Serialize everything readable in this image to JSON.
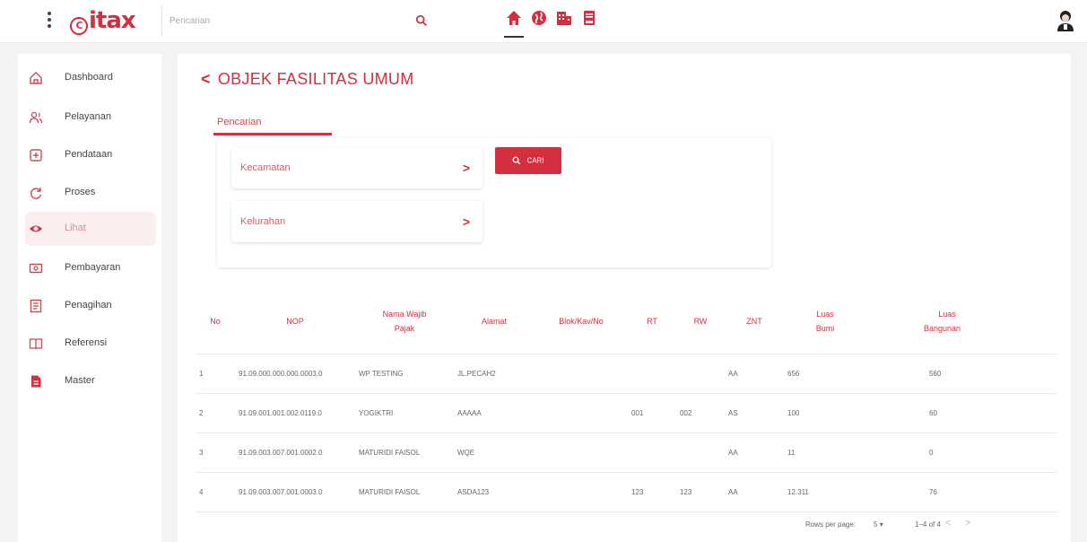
{
  "colors": {
    "accent": "#d32f3f",
    "active_bg": "#fbeeef",
    "background": "#f3f3f3"
  },
  "header": {
    "logo_text": "itax",
    "search_placeholder": "Pencarian"
  },
  "sidebar": {
    "items": [
      {
        "label": "Dashboard",
        "icon": "home-outline-icon"
      },
      {
        "label": "Pelayanan",
        "icon": "users-icon"
      },
      {
        "label": "Pendataan",
        "icon": "add-box-icon"
      },
      {
        "label": "Proses",
        "icon": "sync-icon"
      },
      {
        "label": "Lihat",
        "icon": "eye-icon",
        "active": true
      },
      {
        "label": "Pembayaran",
        "icon": "payment-icon"
      },
      {
        "label": "Penagihan",
        "icon": "bill-icon"
      },
      {
        "label": "Referensi",
        "icon": "book-icon"
      },
      {
        "label": "Master",
        "icon": "file-icon"
      }
    ]
  },
  "main": {
    "title": "OBJEK FASILITAS UMUM",
    "tab": "Pencarian",
    "filters": {
      "kecamatan": "Kecamatan",
      "kelurahan": "Kelurahan"
    },
    "cari_label": "CARI"
  },
  "table": {
    "headers": [
      {
        "line1": "No",
        "line2": ""
      },
      {
        "line1": "NOP",
        "line2": ""
      },
      {
        "line1": "Nama Wajib",
        "line2": "Pajak"
      },
      {
        "line1": "Alamat",
        "line2": ""
      },
      {
        "line1": "Blok/Kav/No",
        "line2": ""
      },
      {
        "line1": "RT",
        "line2": ""
      },
      {
        "line1": "RW",
        "line2": ""
      },
      {
        "line1": "ZNT",
        "line2": ""
      },
      {
        "line1": "Luas",
        "line2": "Bumi"
      },
      {
        "line1": "Luas",
        "line2": "Bangunan"
      }
    ],
    "rows": [
      [
        "1",
        "91.09.000.000.000.0003.0",
        "WP TESTING",
        "JL.PECAH2",
        "",
        "",
        "",
        "AA",
        "656",
        "560"
      ],
      [
        "2",
        "91.09.001.001.002.0119.0",
        "YOGIKTRI",
        "AAAAA",
        "",
        "001",
        "002",
        "AS",
        "100",
        "60"
      ],
      [
        "3",
        "91.09.003.007.001.0002.0",
        "MATURIDI FAISOL",
        "WQE",
        "",
        "",
        "",
        "AA",
        "11",
        "0"
      ],
      [
        "4",
        "91.09.003.007.001.0003.0",
        "MATURIDI FAISOL",
        "ASDA123",
        "",
        "123",
        "123",
        "AA",
        "12.311",
        "76"
      ]
    ]
  },
  "pagination": {
    "rows_per_page_label": "Rows per page:",
    "rows_per_page": "5",
    "range": "1–4 of 4"
  }
}
